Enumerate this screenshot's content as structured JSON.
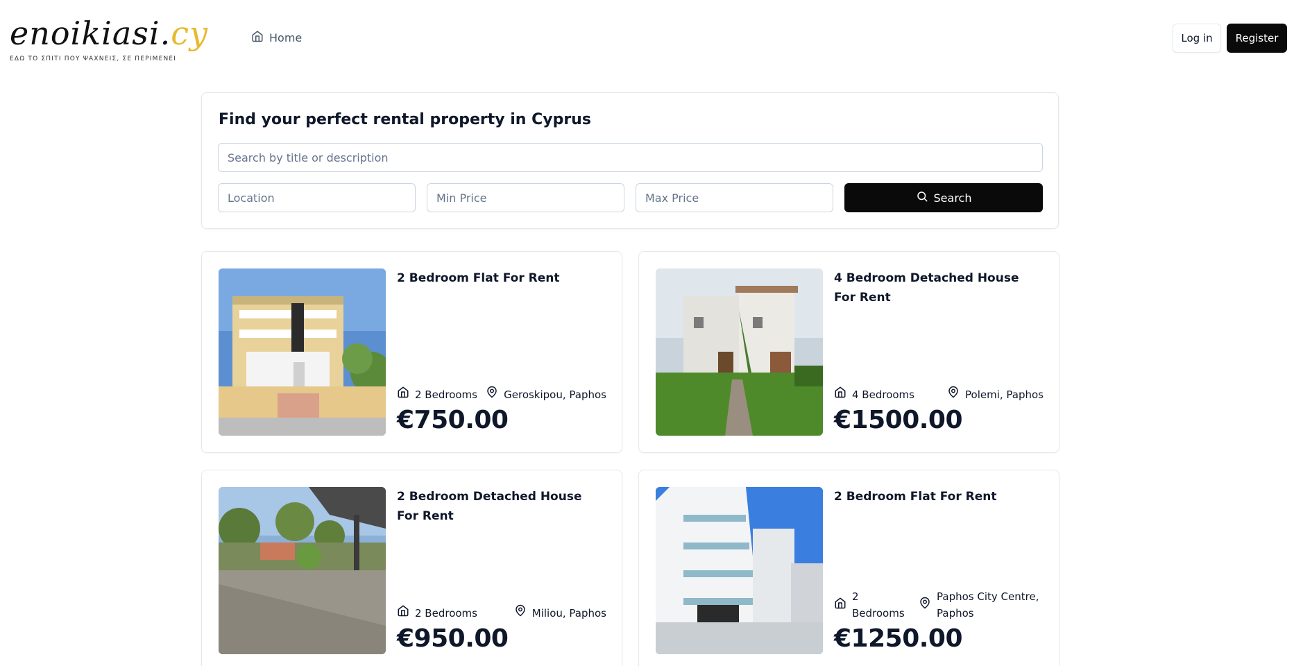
{
  "header": {
    "logo_main": "enoikiasi.",
    "logo_accent": "cy",
    "logo_tagline": "ΕΔΩ ΤΟ ΣΠΙΤΙ ΠΟΥ ΨΑΧΝΕΙΣ, ΣΕ ΠΕΡΙΜΕΝΕΙ",
    "nav_home": "Home",
    "login_label": "Log in",
    "register_label": "Register"
  },
  "search": {
    "title": "Find your perfect rental property in Cyprus",
    "text_placeholder": "Search by title or description",
    "location_placeholder": "Location",
    "min_price_placeholder": "Min Price",
    "max_price_placeholder": "Max Price",
    "button_label": "Search"
  },
  "listings": [
    {
      "title": "2 Bedroom Flat For Rent",
      "bedrooms": "2 Bedrooms",
      "location": "Geroskipou, Paphos",
      "price": "€750.00"
    },
    {
      "title": "4 Bedroom Detached House For Rent",
      "bedrooms": "4 Bedrooms",
      "location": "Polemi, Paphos",
      "price": "€1500.00"
    },
    {
      "title": "2 Bedroom Detached House For Rent",
      "bedrooms": "2 Bedrooms",
      "location": "Miliou, Paphos",
      "price": "€950.00"
    },
    {
      "title": "2 Bedroom Flat For Rent",
      "bedrooms": "2 Bedrooms",
      "location": "Paphos City Centre, Paphos",
      "price": "€1250.00"
    }
  ],
  "colors": {
    "accent_logo": "#e8b92e",
    "button_dark": "#0a0a0a",
    "text_primary": "#0f172a",
    "text_muted": "#64748b"
  },
  "icons": {
    "nav": "home-icon",
    "search_button": "search-icon",
    "bedrooms": "house-icon",
    "location": "map-pin-icon"
  }
}
